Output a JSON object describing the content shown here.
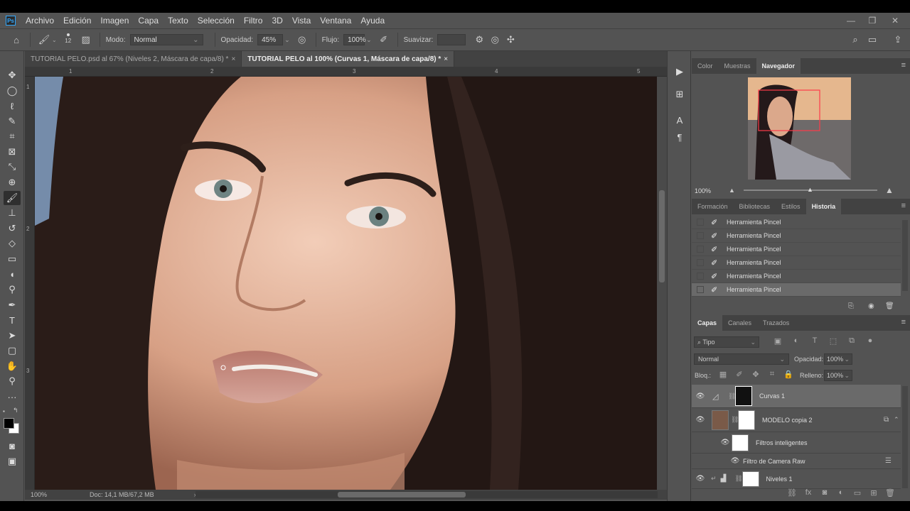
{
  "menu": [
    "Archivo",
    "Edición",
    "Imagen",
    "Capa",
    "Texto",
    "Selección",
    "Filtro",
    "3D",
    "Vista",
    "Ventana",
    "Ayuda"
  ],
  "app_logo": "Ps",
  "options": {
    "brush_size": "12",
    "mode_label": "Modo:",
    "mode_value": "Normal",
    "opacity_label": "Opacidad:",
    "opacity_value": "45%",
    "flow_label": "Flujo:",
    "flow_value": "100%",
    "smooth_label": "Suavizar:",
    "smooth_value": ""
  },
  "doc_tabs": [
    {
      "label": "TUTORIAL PELO.psd al 67% (Niveles 2, Máscara de capa/8) *",
      "close": "×"
    },
    {
      "label": "TUTORIAL PELO al 100% (Curvas 1, Máscara de capa/8) *",
      "close": "×"
    }
  ],
  "ruler": {
    "h": [
      "1",
      "2",
      "3",
      "4",
      "5"
    ],
    "v": [
      "1",
      "2",
      "3"
    ]
  },
  "status": {
    "zoom": "100%",
    "doc": "Doc: 14,1 MB/67,2 MB"
  },
  "navigator": {
    "tabs": [
      "Color",
      "Muestras",
      "Navegador"
    ],
    "zoom": "100%"
  },
  "history": {
    "tabs": [
      "Formación",
      "Bibliotecas",
      "Estilos",
      "Historia"
    ],
    "items": [
      "Herramienta Pincel",
      "Herramienta Pincel",
      "Herramienta Pincel",
      "Herramienta Pincel",
      "Herramienta Pincel",
      "Herramienta Pincel"
    ]
  },
  "layers": {
    "tabs": [
      "Capas",
      "Canales",
      "Trazados"
    ],
    "filter": "Tipo",
    "blend": "Normal",
    "opacity_label": "Opacidad:",
    "opacity": "100%",
    "lock_label": "Bloq.:",
    "fill_label": "Relleno:",
    "fill": "100%",
    "items": [
      {
        "name": "Curvas 1"
      },
      {
        "name": "MODELO copia 2"
      },
      {
        "name": "Filtros inteligentes"
      },
      {
        "name": "Filtro de Camera Raw"
      },
      {
        "name": "Niveles 1"
      }
    ]
  },
  "colors": {
    "accent": "#31a8ff",
    "panel": "#535353",
    "dark": "#424242"
  }
}
